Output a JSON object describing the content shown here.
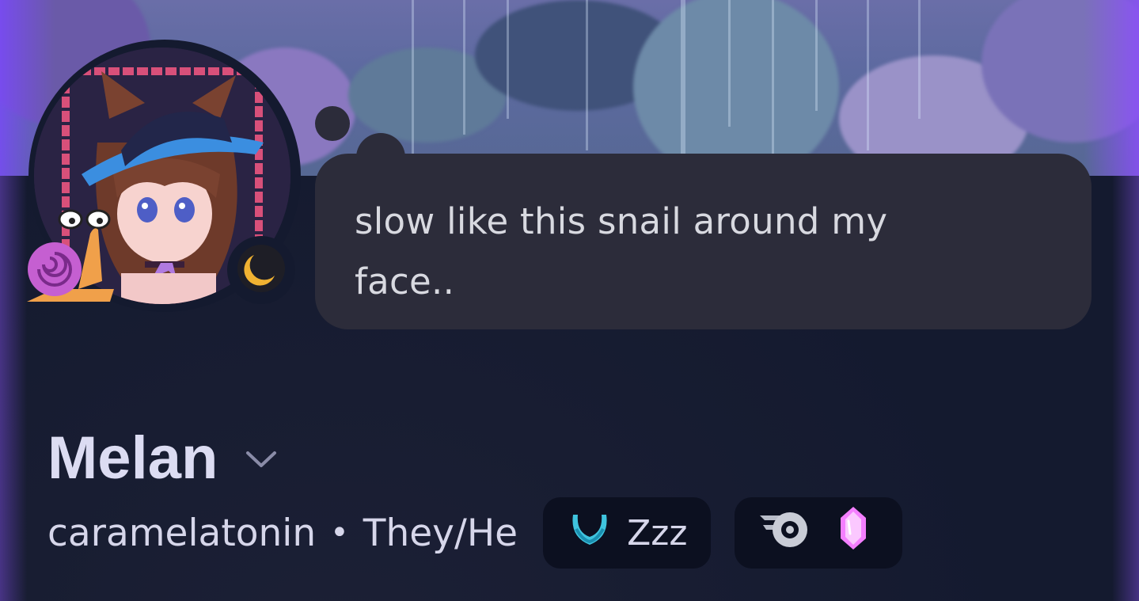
{
  "profile": {
    "display_name": "Melan",
    "username": "caramelatonin",
    "separator": "•",
    "pronouns": "They/He",
    "custom_status": {
      "text": "slow like this snail around my face..",
      "line1": "slow like this snail around my",
      "line2": "face.."
    },
    "activity_chip": {
      "icon": "crescent-moon-icon",
      "label": "Zzz"
    },
    "badges": [
      "hypesquad-icon",
      "nitro-gem-icon"
    ],
    "presence": "idle-moon-icon"
  },
  "colors": {
    "accent_purple": "#7b48ff",
    "bubble_bg": "#2c2c3a",
    "page_bg": "#141a2f",
    "idle_yellow": "#f0b232",
    "gem_pink": "#f47fff"
  }
}
